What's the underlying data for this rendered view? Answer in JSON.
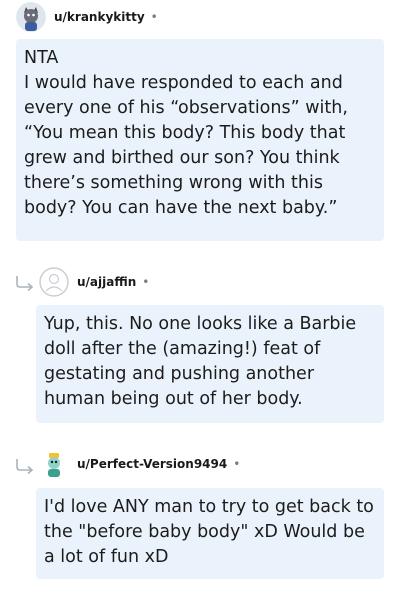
{
  "comments": [
    {
      "username": "u/krankykitty",
      "separator": "•",
      "avatar_icon": "cat-avatar-icon",
      "body": [
        "NTA",
        "I would have responded to each and every one of his “observations” with, “You mean this body? This body that grew and birthed our son? You think there’s something wrong with this body? You can have the next baby.”"
      ]
    },
    {
      "username": "u/ajjaffin",
      "separator": "•",
      "avatar_icon": "default-avatar-icon",
      "reply_icon": "reply-arrow-icon",
      "body": [
        "Yup, this. No one looks like a Barbie doll after the (amazing!) feat of gestating and pushing another human being out of her body."
      ]
    },
    {
      "username": "u/Perfect-Version9494",
      "separator": "•",
      "avatar_icon": "robot-avatar-icon",
      "reply_icon": "reply-arrow-icon",
      "body": [
        "I'd love ANY man to try to get back to the \"before baby body\" xD Would be a lot of fun xD"
      ]
    }
  ],
  "colors": {
    "bubble_bg": "#eaf3fb",
    "text": "#1c1c1c",
    "meta": "#7c7c7c"
  }
}
